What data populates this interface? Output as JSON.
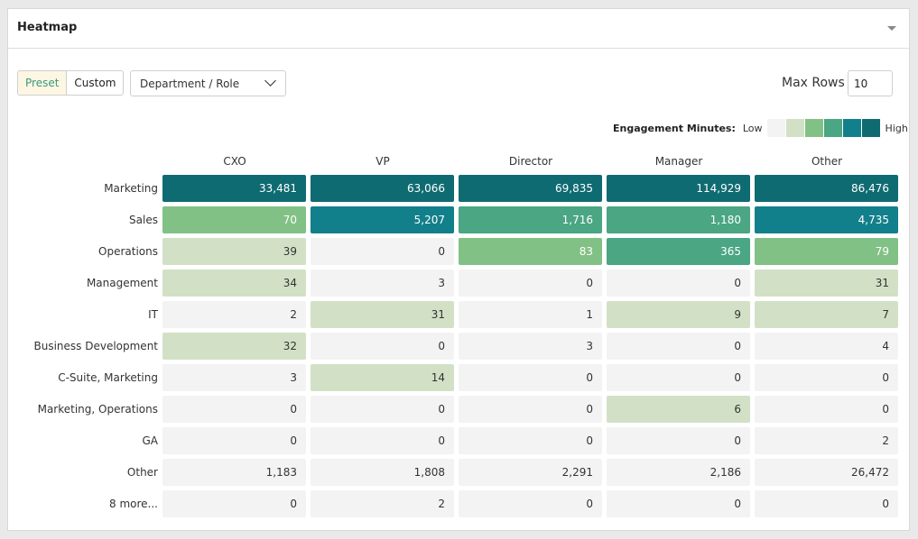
{
  "card": {
    "title": "Heatmap"
  },
  "controls": {
    "preset_label": "Preset",
    "custom_label": "Custom",
    "dimension_select": "Department / Role",
    "max_rows_label": "Max Rows",
    "max_rows_value": "10"
  },
  "legend": {
    "title": "Engagement Minutes:",
    "low": "Low",
    "high": "High",
    "colors": [
      "#f3f3f3",
      "#d2e1c6",
      "#82c185",
      "#4aa683",
      "#12808a",
      "#0f6b72"
    ]
  },
  "chart_data": {
    "type": "heatmap",
    "columns": [
      "CXO",
      "VP",
      "Director",
      "Manager",
      "Other"
    ],
    "rows": [
      {
        "label": "Marketing",
        "values": [
          "33,481",
          "63,066",
          "69,835",
          "114,929",
          "86,476"
        ],
        "levels": [
          5,
          5,
          5,
          5,
          5
        ]
      },
      {
        "label": "Sales",
        "values": [
          "70",
          "5,207",
          "1,716",
          "1,180",
          "4,735"
        ],
        "levels": [
          2,
          4,
          3,
          3,
          4
        ]
      },
      {
        "label": "Operations",
        "values": [
          "39",
          "0",
          "83",
          "365",
          "79"
        ],
        "levels": [
          1,
          0,
          2,
          3,
          2
        ]
      },
      {
        "label": "Management",
        "values": [
          "34",
          "3",
          "0",
          "0",
          "31"
        ],
        "levels": [
          1,
          0,
          0,
          0,
          1
        ]
      },
      {
        "label": "IT",
        "values": [
          "2",
          "31",
          "1",
          "9",
          "7"
        ],
        "levels": [
          0,
          1,
          0,
          1,
          1
        ]
      },
      {
        "label": "Business Development",
        "values": [
          "32",
          "0",
          "3",
          "0",
          "4"
        ],
        "levels": [
          1,
          0,
          0,
          0,
          0
        ]
      },
      {
        "label": "C-Suite, Marketing",
        "values": [
          "3",
          "14",
          "0",
          "0",
          "0"
        ],
        "levels": [
          0,
          1,
          0,
          0,
          0
        ]
      },
      {
        "label": "Marketing, Operations",
        "values": [
          "0",
          "0",
          "0",
          "6",
          "0"
        ],
        "levels": [
          0,
          0,
          0,
          1,
          0
        ]
      },
      {
        "label": "GA",
        "values": [
          "0",
          "0",
          "0",
          "0",
          "2"
        ],
        "levels": [
          0,
          0,
          0,
          0,
          0
        ]
      },
      {
        "label": "Other",
        "values": [
          "1,183",
          "1,808",
          "2,291",
          "2,186",
          "26,472"
        ],
        "levels": [
          0,
          0,
          0,
          0,
          0
        ]
      },
      {
        "label": "8 more...",
        "values": [
          "0",
          "2",
          "0",
          "0",
          "0"
        ],
        "levels": [
          0,
          0,
          0,
          0,
          0
        ]
      }
    ]
  }
}
